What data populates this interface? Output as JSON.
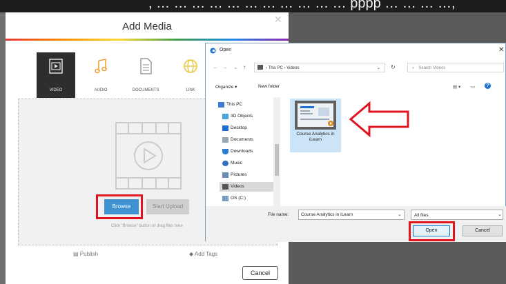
{
  "top_caption": ", … … … … … … … … … … … pppp … … … …,",
  "add_media": {
    "title": "Add Media",
    "close_glyph": "✕",
    "tabs": [
      {
        "label": "VIDEO",
        "icon": "video-icon",
        "active": true
      },
      {
        "label": "AUDIO",
        "icon": "music-note-icon",
        "active": false
      },
      {
        "label": "DOCUMENTS",
        "icon": "document-icon",
        "active": false
      },
      {
        "label": "LINK",
        "icon": "globe-icon",
        "active": false
      }
    ],
    "browse_label": "Browse",
    "start_upload_label": "Start Upload",
    "hint": "Click \"Browse\" button or drag files here",
    "publish_label": "Publish",
    "add_tags_label": "Add Tags",
    "cancel_label": "Cancel",
    "rainbow_colors": [
      "#e53935",
      "#fb8c00",
      "#fdd835",
      "#43a047",
      "#1e88e5",
      "#8e24aa"
    ]
  },
  "open_dialog": {
    "title": "Open",
    "close_glyph": "✕",
    "breadcrumb": "›  This PC  ›  Videos",
    "search_placeholder": "Search Videos",
    "organize_label": "Organize ▾",
    "new_folder_label": "New folder",
    "nav_items": [
      {
        "label": "This PC",
        "icon": "computer-icon"
      },
      {
        "label": "3D Objects",
        "icon": "3d-objects-icon"
      },
      {
        "label": "Desktop",
        "icon": "desktop-icon"
      },
      {
        "label": "Documents",
        "icon": "documents-icon"
      },
      {
        "label": "Downloads",
        "icon": "download-icon"
      },
      {
        "label": "Music",
        "icon": "music-icon"
      },
      {
        "label": "Pictures",
        "icon": "pictures-icon"
      },
      {
        "label": "Videos",
        "icon": "videos-icon",
        "selected": true
      },
      {
        "label": "OS (C:)",
        "icon": "drive-icon"
      }
    ],
    "file": {
      "name": "Course Analytics in iLearn"
    },
    "file_name_label": "File name:",
    "file_name_value": "Course Analytics in iLearn",
    "file_type": "All files",
    "open_label": "Open",
    "cancel_label": "Cancel"
  },
  "colors": {
    "accent_red": "#e0141e",
    "browse_blue": "#3f93d3",
    "selection_blue": "#cce4f7"
  }
}
